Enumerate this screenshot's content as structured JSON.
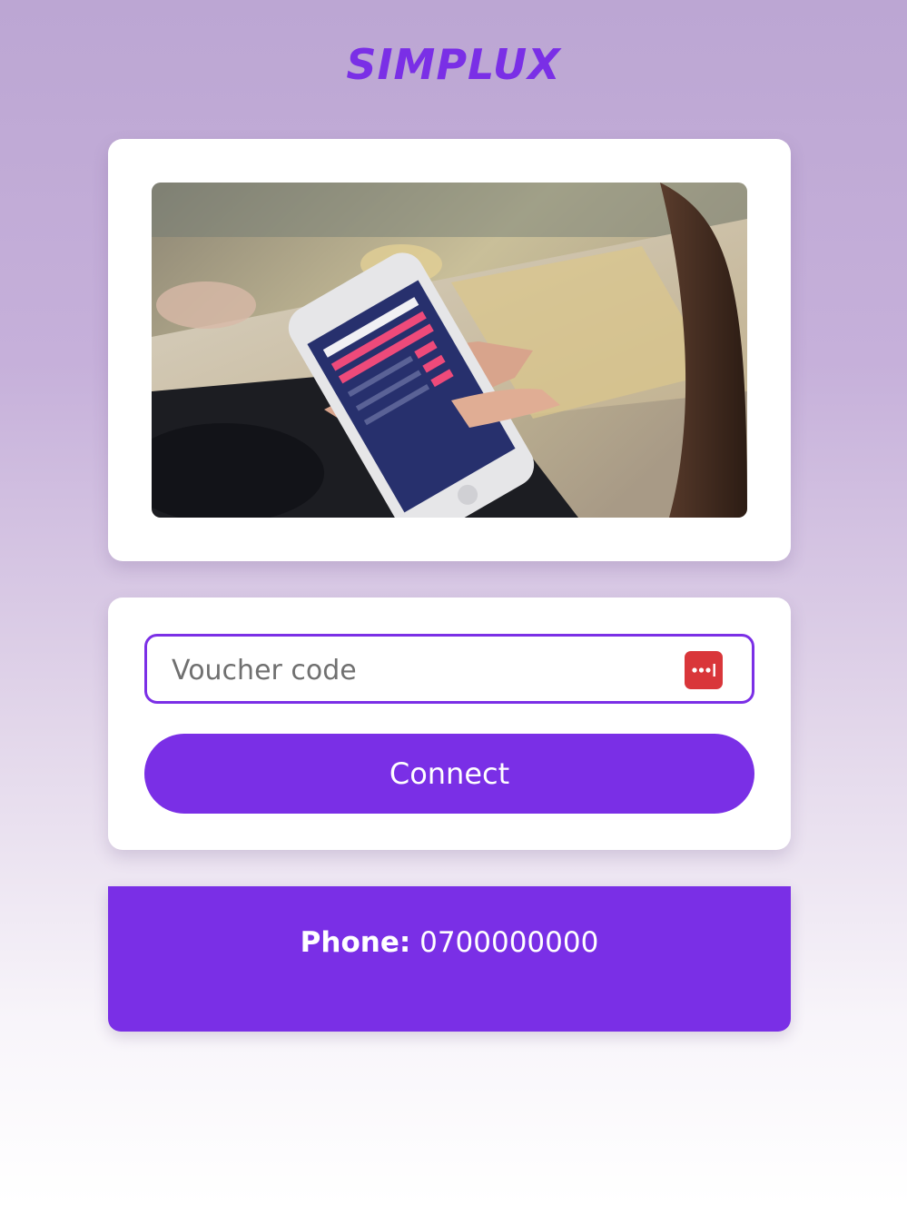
{
  "brand": {
    "logo_text": "SIMPLUX"
  },
  "hero": {
    "alt": "Person holding a phone showing the SIMPLUX hotspot portal"
  },
  "form": {
    "voucher_placeholder": "Voucher code",
    "voucher_value": "",
    "connect_label": "Connect"
  },
  "contact": {
    "phone_label": "Phone:",
    "phone_value": "0700000000"
  },
  "colors": {
    "accent": "#7a2fe6",
    "password_manager_icon": "#d9363a"
  }
}
